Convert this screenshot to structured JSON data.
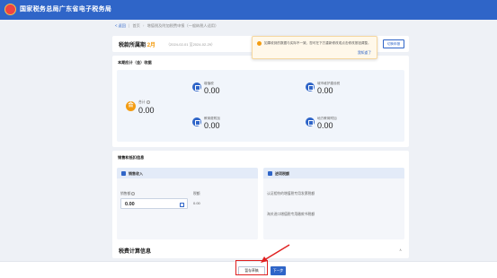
{
  "app": {
    "title": "国家税务总局广东省电子税务局"
  },
  "breadcrumb": {
    "back": "返回",
    "home": "首页",
    "current": "增值税及附加税费申报（一般纳税人适用）"
  },
  "period": {
    "label": "税款所属期",
    "month": "2月",
    "range": "（2024-02-01 至2024-02-29）"
  },
  "toolbar": {
    "button_label": "切换申报"
  },
  "notice": {
    "message": "如果收到的数据与实际不一致，您可在下方重新修改或点击修改按钮调整。",
    "confirm": "我知道了"
  },
  "income": {
    "title": "本期应计（金）收据",
    "total_label": "合计",
    "total_value": "0.00",
    "items": [
      {
        "label": "增值税",
        "value": "0.00"
      },
      {
        "label": "城市维护建设税",
        "value": "0.00"
      },
      {
        "label": "教育费附加",
        "value": "0.00"
      },
      {
        "label": "地方教育附加",
        "value": "0.00"
      }
    ]
  },
  "deduction": {
    "title": "销售和抵扣信息",
    "sales": {
      "title": "销售收入",
      "field1_label": "销售额",
      "field1_value": "0.00",
      "field2_label": "税额",
      "field2_value": "0.00"
    },
    "input_tax": {
      "title": "进项税额",
      "line1": "认证相符的增值税专用发票税额",
      "line2": "海关进口增值税专用缴款书税额"
    }
  },
  "calc": {
    "title": "税费计算信息",
    "chevron": "∧"
  },
  "footer": {
    "draft_label": "暂存草稿",
    "next_label": "下一步"
  }
}
